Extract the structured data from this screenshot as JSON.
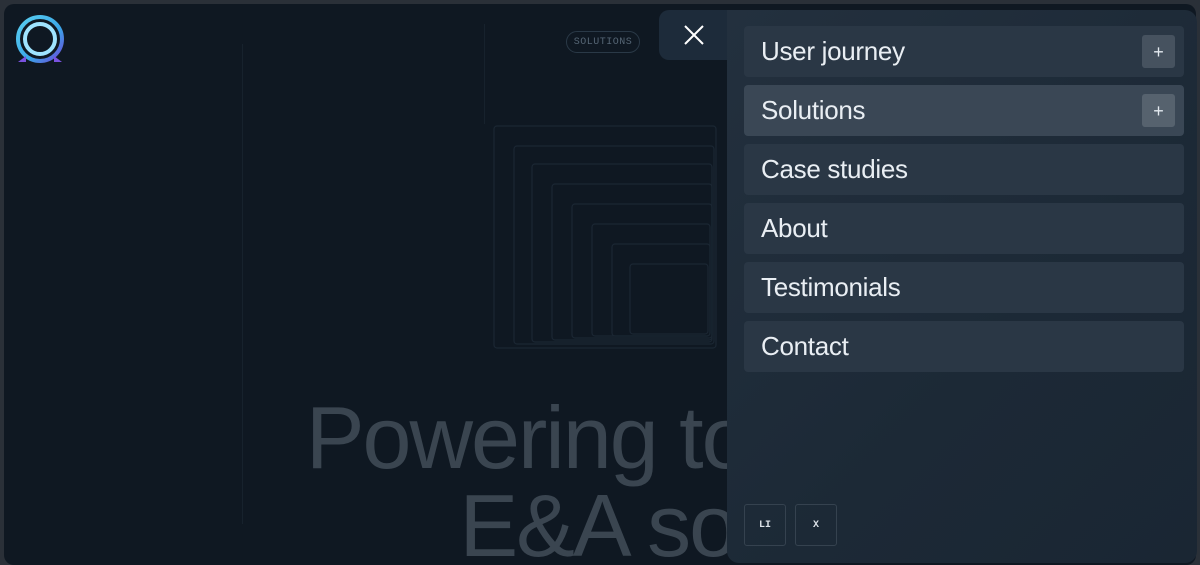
{
  "brand": {
    "logo_icon": "ring-logo-icon"
  },
  "background": {
    "section_tag": "SOLUTIONS",
    "hero_line1": "Powering tomor",
    "hero_line2": "E&A soluti"
  },
  "overlay": {
    "close_icon": "close-icon"
  },
  "menu": {
    "items": [
      {
        "label": "User journey",
        "has_expand": true,
        "active": false
      },
      {
        "label": "Solutions",
        "has_expand": true,
        "active": true
      },
      {
        "label": "Case studies",
        "has_expand": false,
        "active": false
      },
      {
        "label": "About",
        "has_expand": false,
        "active": false
      },
      {
        "label": "Testimonials",
        "has_expand": false,
        "active": false
      },
      {
        "label": "Contact",
        "has_expand": false,
        "active": false
      }
    ],
    "expand_symbol": "+"
  },
  "social": {
    "linkedin": "LI",
    "x": "X"
  },
  "colors": {
    "page_bg": "#0f1822",
    "panel_bg": "#1f2c3a",
    "item_bg": "#2a3745",
    "item_active_bg": "#3a4755",
    "text": "#e9eef3"
  }
}
